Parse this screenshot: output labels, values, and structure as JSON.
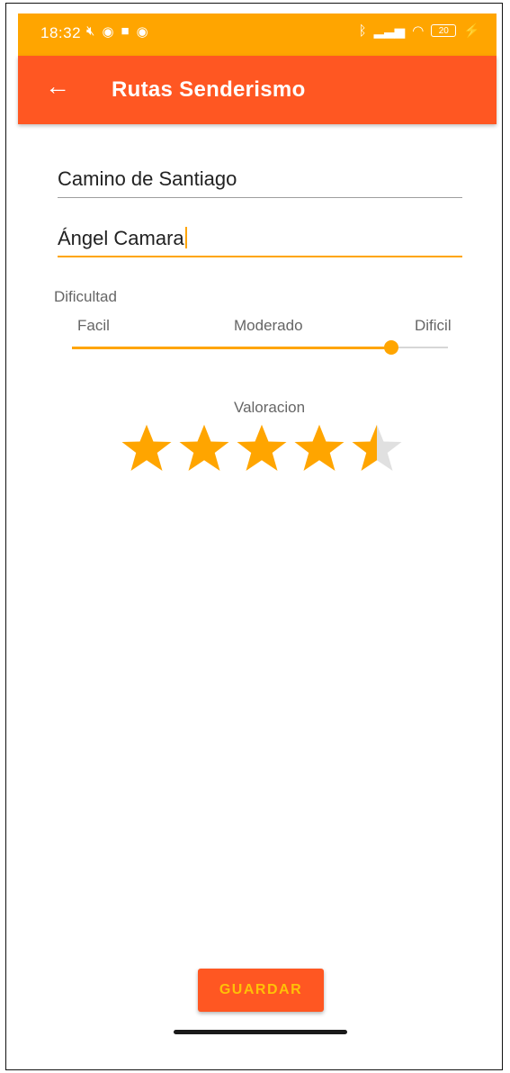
{
  "status_bar": {
    "time": "18:32",
    "left_icons": [
      "mute-icon",
      "notification-icon",
      "app-icon",
      "notification-icon"
    ],
    "battery_level": "20",
    "colors": {
      "background": "#FFA500",
      "text": "#ffffff"
    }
  },
  "app_bar": {
    "title": "Rutas Senderismo",
    "back_icon": "arrow-left-icon",
    "colors": {
      "background": "#FF5722",
      "text": "#ffffff"
    }
  },
  "form": {
    "route_name": "Camino de Santiago",
    "author_name": "Ángel Camara",
    "difficulty": {
      "label": "Dificultad",
      "levels": [
        "Facil",
        "Moderado",
        "Dificil"
      ],
      "value_fraction": 0.85
    },
    "rating": {
      "label": "Valoracion",
      "value": 4.5,
      "max": 5
    }
  },
  "save_button": {
    "label": "GUARDAR"
  },
  "accent_color": "#FFA500"
}
